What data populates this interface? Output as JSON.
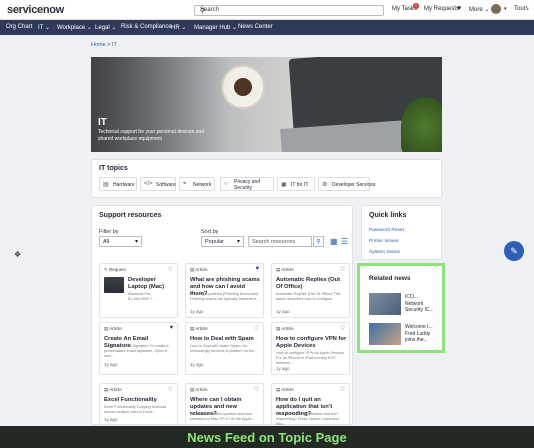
{
  "header": {
    "logo": "servicenow",
    "search_label": "Search",
    "search_icon": "search-icon",
    "my_tasks": "My Tasks",
    "tasks_badge": "0",
    "my_requests": "My Requests",
    "more": "More ⌄",
    "tours": "Tours"
  },
  "nav": {
    "items": [
      "Org Chart",
      "IT ⌄",
      "Workplace ⌄",
      "Legal ⌄",
      "Risk & Compliance",
      "HR ⌄",
      "Manager Hub ⌄",
      "News Center"
    ]
  },
  "breadcrumb": {
    "home": "Home",
    "sep": ">",
    "current": "IT"
  },
  "hero": {
    "title": "IT",
    "subtitle": "Technical support for your personal devices and shared workplace equipment"
  },
  "topics": {
    "title": "IT topics",
    "items": [
      {
        "label": "Hardware",
        "icon": "laptop-icon"
      },
      {
        "label": "Software",
        "icon": "code-icon"
      },
      {
        "label": "Network",
        "icon": "network-icon"
      },
      {
        "label": "Privacy and Security",
        "icon": "lock-icon"
      },
      {
        "label": "IT for IT",
        "icon": "it-icon"
      },
      {
        "label": "Developer Services",
        "icon": "gear-icon"
      }
    ]
  },
  "support": {
    "title": "Support resources",
    "filter_label": "Filter by",
    "filter_value": "All",
    "sort_label": "Sort by",
    "sort_value": "Popular",
    "search_placeholder": "Search resources",
    "cards": [
      {
        "type": "Request",
        "title": "Developer Laptop (Mac)",
        "desc": "Macbook Pro",
        "price": "$1,168.0990 + ...",
        "age": "",
        "favorite": false
      },
      {
        "type": "Article",
        "title": "What are phishing scams and how can I avoid them?",
        "desc": "Phishing explained (Phishing Encounter) Phishing scams are typically fraudulent...",
        "age": "1y ago",
        "favorite": true
      },
      {
        "type": "Article",
        "title": "Automatic Replies (Out Of Office)",
        "desc": "Automatic Replies (Out Of Office) This article describes how to configure...",
        "age": "1y ago",
        "favorite": false
      },
      {
        "type": "Article",
        "title": "Create An Email Signature",
        "desc": "Create An Email Signature To create a personalized email signature: Open a new...",
        "age": "1y ago",
        "favorite": true
      },
      {
        "type": "Article",
        "title": "How to Deal with Spam",
        "desc": "How to Deal with Spam Spam: No increasingly become a problem on the...",
        "age": "1y ago",
        "favorite": false
      },
      {
        "type": "Article",
        "title": "How to configure VPN for Apple Devices",
        "desc": "How to configure VPN for Apple Devices For an iPhone or iPad running iOS7 between...",
        "age": "1y ago",
        "favorite": false
      },
      {
        "type": "Article",
        "title": "Excel Functionality",
        "desc": "Excel Functionality Copying formulas across multiple cells in Excel...",
        "age": "1y ago",
        "favorite": false
      },
      {
        "type": "Article",
        "title": "Where can I obtain updates and new releases?",
        "desc": "Where can I obtain updates and new releases for Mac OS X? At the Apple...",
        "age": "1y ago",
        "favorite": false
      },
      {
        "type": "Article",
        "title": "How do I quit an application that isn't responding?",
        "desc": "How do I quit an application that isn't responding? Press Option-Command-Esc...",
        "age": "1y ago",
        "favorite": false
      }
    ]
  },
  "quick_links": {
    "title": "Quick links",
    "items": [
      "Password Reset",
      "Printer Issues",
      "System Status"
    ]
  },
  "related_news": {
    "title": "Related news",
    "items": [
      {
        "title": "ICO... Network Security IC..."
      },
      {
        "title": "Welcome t... Fred Luddy joins the..."
      }
    ]
  },
  "caption": "News Feed on Topic Page",
  "colors": {
    "nav": "#2f3a5a",
    "link": "#2b5fb3",
    "highlight": "#8fe37a"
  }
}
